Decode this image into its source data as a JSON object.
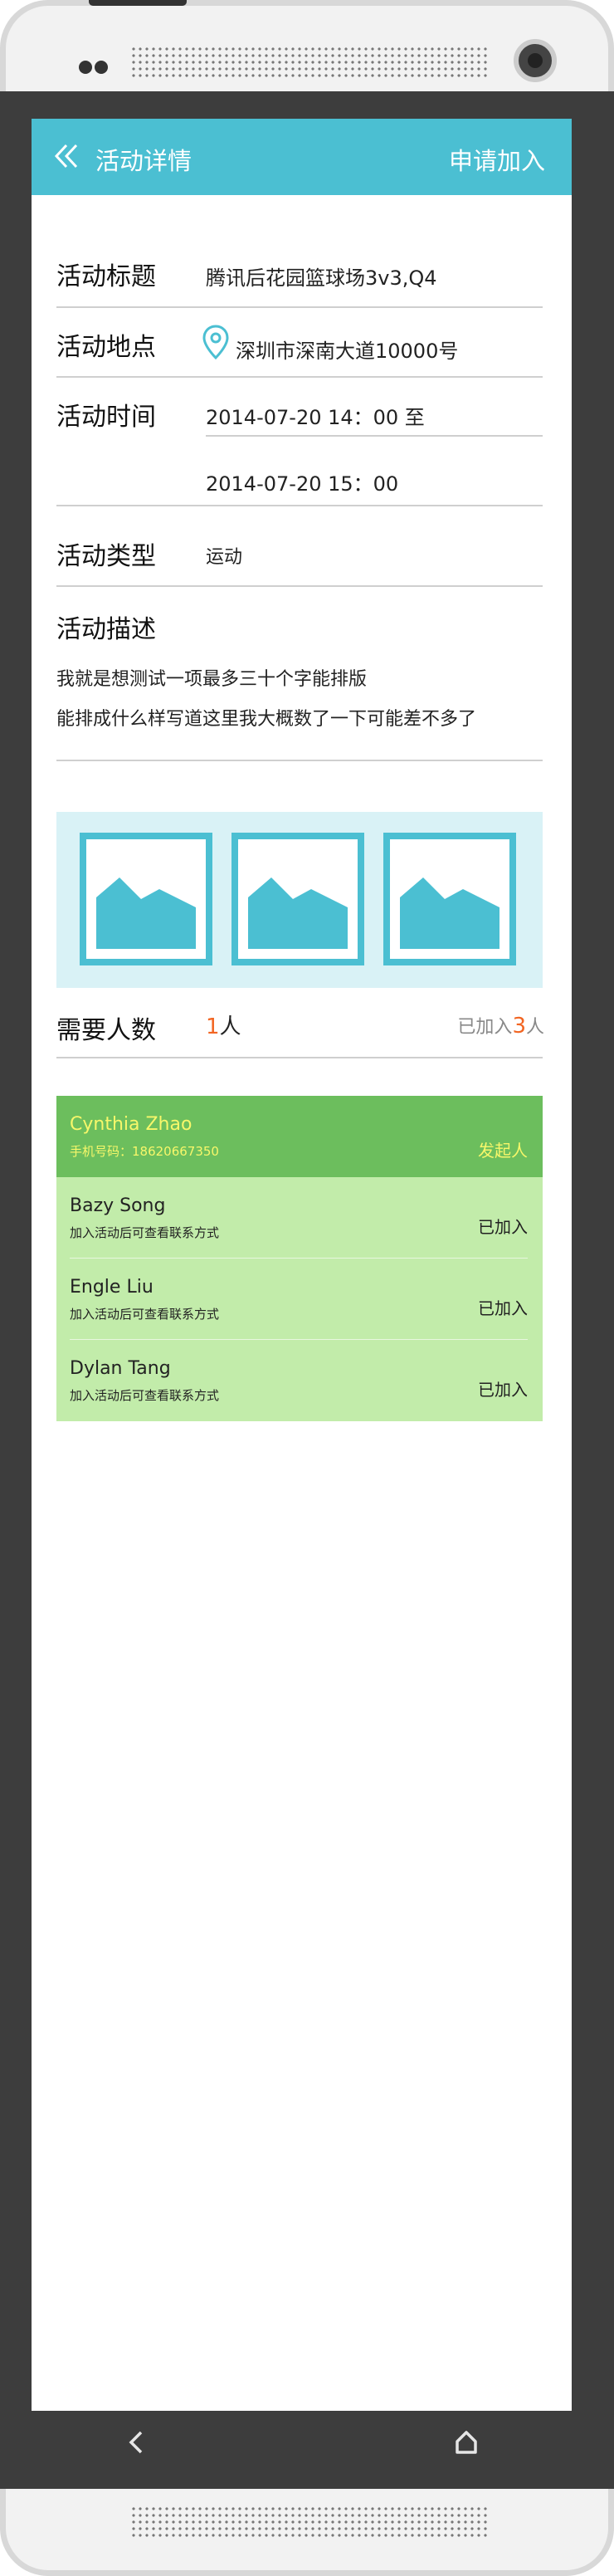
{
  "header": {
    "title": "活动详情",
    "apply_label": "申请加入"
  },
  "fields": {
    "title_label": "活动标题",
    "title_value": "腾讯后花园篮球场3v3,Q4",
    "location_label": "活动地点",
    "location_value": "深圳市深南大道10000号",
    "time_label": "活动时间",
    "time_start": "2014-07-20 14：00 至",
    "time_end": "2014-07-20 15：00",
    "type_label": "活动类型",
    "type_value": "运动",
    "desc_label": "活动描述",
    "desc_line1": "我就是想测试一项最多三十个字能排版",
    "desc_line2": "能排成什么样写道这里我大概数了一下可能差不多了"
  },
  "need": {
    "label": "需要人数",
    "count": "1",
    "unit": "人",
    "joined_prefix": "已加入",
    "joined_count": "3",
    "joined_unit": "人"
  },
  "organizer": {
    "name": "Cynthia Zhao",
    "phone": "手机号码：18620667350",
    "role": "发起人"
  },
  "members": [
    {
      "name": "Bazy Song",
      "note": "加入活动后可查看联系方式",
      "status": "已加入"
    },
    {
      "name": "Engle Liu",
      "note": "加入活动后可查看联系方式",
      "status": "已加入"
    },
    {
      "name": "Dylan Tang",
      "note": "加入活动后可查看联系方式",
      "status": "已加入"
    }
  ],
  "colors": {
    "accent": "#4bbfd2",
    "highlight": "#f26522",
    "organizer_bg": "#6cbe5d",
    "member_bg": "#c2ecaa",
    "organizer_text": "#f7f76a"
  },
  "icons": {
    "back": "chevron-double-left-icon",
    "location": "map-pin-icon",
    "image": "image-placeholder-icon",
    "nav_back": "chevron-left-icon",
    "nav_home": "home-icon"
  }
}
